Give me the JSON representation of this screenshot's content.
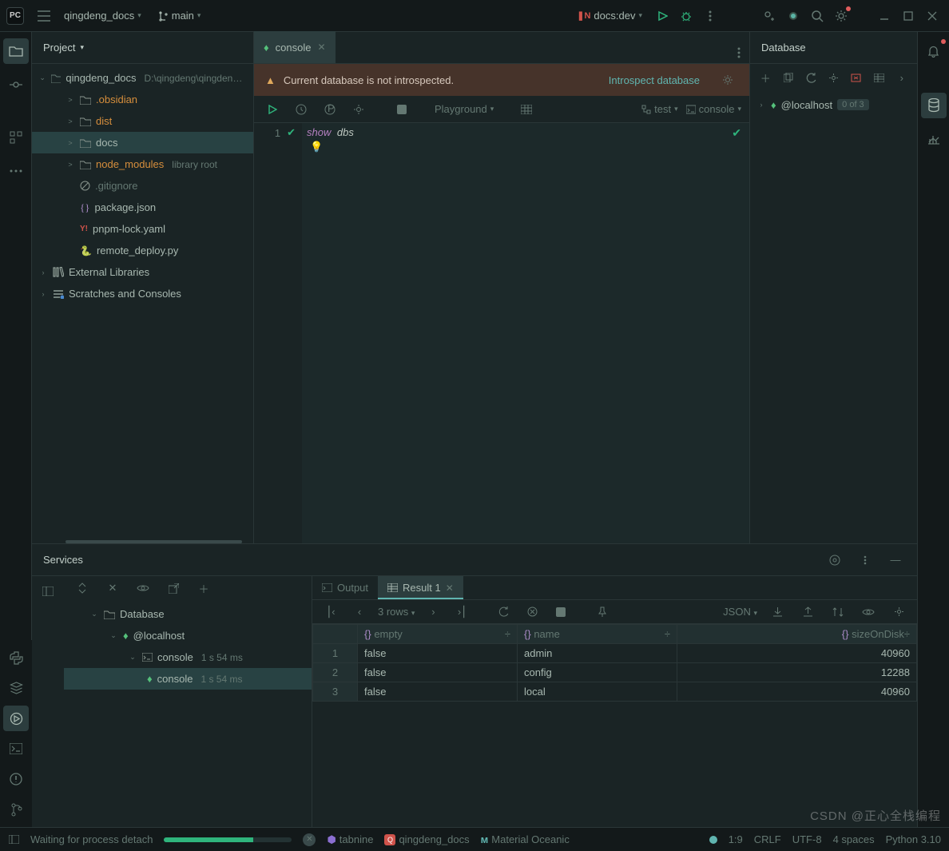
{
  "titlebar": {
    "project": "qingdeng_docs",
    "branch": "main",
    "runConfig": "docs:dev"
  },
  "projectPanel": {
    "title": "Project",
    "root": {
      "name": "qingdeng_docs",
      "path": "D:\\qingdeng\\qingdeng_docs"
    },
    "items": [
      {
        "name": ".obsidian",
        "kind": "folder",
        "color": "orange",
        "indent": 1,
        "caret": ">"
      },
      {
        "name": "dist",
        "kind": "folder",
        "color": "orange",
        "indent": 1,
        "caret": ">"
      },
      {
        "name": "docs",
        "kind": "folder",
        "color": "normal",
        "indent": 1,
        "caret": ">",
        "selected": true
      },
      {
        "name": "node_modules",
        "kind": "folder",
        "color": "orange",
        "indent": 1,
        "caret": ">",
        "detail": "library root"
      },
      {
        "name": ".gitignore",
        "kind": "file-block",
        "color": "mut",
        "indent": 1
      },
      {
        "name": "package.json",
        "kind": "file-json",
        "color": "normal",
        "indent": 1
      },
      {
        "name": "pnpm-lock.yaml",
        "kind": "file-yaml",
        "color": "red",
        "indent": 1
      },
      {
        "name": "remote_deploy.py",
        "kind": "file-py",
        "color": "normal",
        "indent": 1
      }
    ],
    "extLib": "External Libraries",
    "scratch": "Scratches and Consoles"
  },
  "editor": {
    "tab": "console",
    "warning": "Current database is not introspected.",
    "warningLink": "Introspect database",
    "toolbar": {
      "playground": "Playground",
      "txSchema": "test",
      "txConsole": "console"
    },
    "lineNo": "1",
    "code": {
      "kw": "show",
      "id": "dbs"
    }
  },
  "database": {
    "title": "Database",
    "item": {
      "name": "@localhost",
      "badge": "0 of 3"
    }
  },
  "services": {
    "title": "Services",
    "tree": {
      "root": "Database",
      "host": "@localhost",
      "consoleGrp": {
        "name": "console",
        "time": "1 s 54 ms"
      },
      "consoleItem": {
        "name": "console",
        "time": "1 s 54 ms"
      }
    },
    "resultTabs": {
      "output": "Output",
      "result": "Result 1"
    },
    "resultToolbar": {
      "rows": "3 rows",
      "format": "JSON"
    },
    "columns": [
      "empty",
      "name",
      "sizeOnDisk"
    ],
    "rows": [
      {
        "empty": "false",
        "name": "admin",
        "sizeOnDisk": "40960"
      },
      {
        "empty": "false",
        "name": "config",
        "sizeOnDisk": "12288"
      },
      {
        "empty": "false",
        "name": "local",
        "sizeOnDisk": "40960"
      }
    ]
  },
  "status": {
    "process": "Waiting for process detach",
    "tabnine": "tabnine",
    "project": "qingdeng_docs",
    "theme": "Material Oceanic",
    "pos": "1:9",
    "eol": "CRLF",
    "enc": "UTF-8",
    "indent": "4 spaces",
    "lang": "Python 3.10"
  },
  "watermark": "CSDN @正心全栈编程"
}
